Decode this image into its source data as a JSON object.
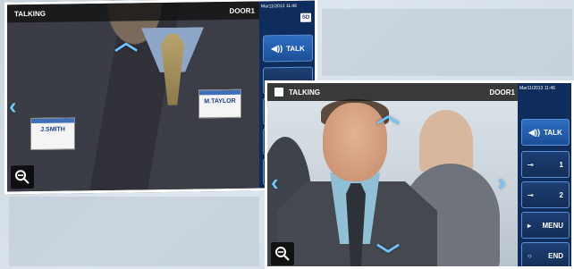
{
  "screen_back": {
    "status": "TALKING",
    "door": "DOOR1",
    "clock": "Mar11/2013 11:46",
    "sd_label": "SD",
    "talk_label": "TALK",
    "badge_left": "J.SMITH",
    "badge_right": "M.TAYLOR"
  },
  "screen_front": {
    "status": "TALKING",
    "door": "DOOR1",
    "clock": "Mar11/2013 11:46",
    "talk_label": "TALK",
    "key1_label": "1",
    "key2_label": "2",
    "menu_label": "MENU",
    "end_label": "END"
  },
  "icons": {
    "zoom": "zoom-out-icon",
    "arrows": [
      "arrow-up-icon",
      "arrow-left-icon",
      "arrow-right-icon",
      "arrow-down-icon"
    ],
    "talk": "speaker-icon",
    "key": "key-icon"
  },
  "colors": {
    "accent_arrow": "#6fc5ff",
    "sidebar": "#0f2d5c",
    "button": "#2e6fc2"
  }
}
